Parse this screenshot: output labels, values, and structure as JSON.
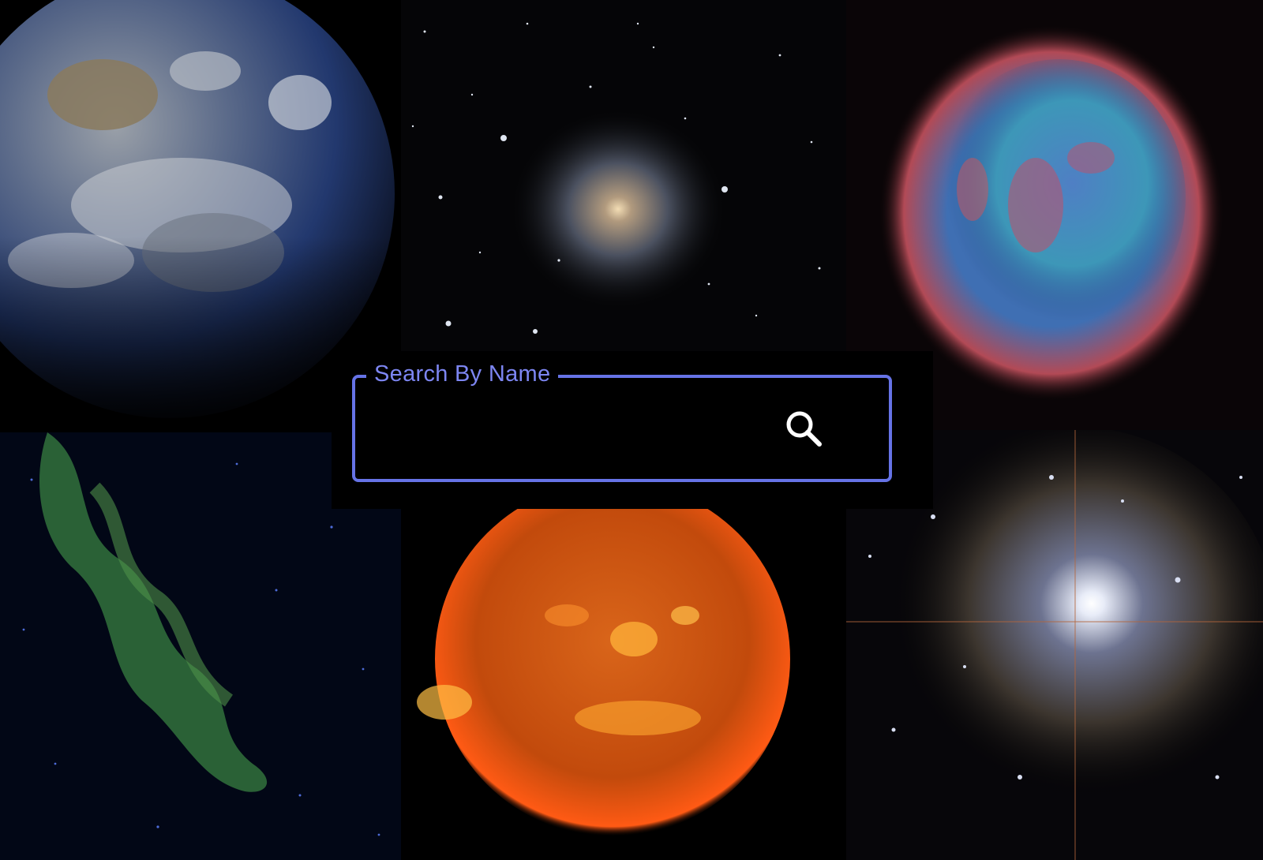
{
  "search": {
    "label": "Search By Name",
    "value": "",
    "placeholder": ""
  },
  "icons": {
    "search": "search-icon"
  },
  "colors": {
    "accent": "#6673e6",
    "label": "#7d86f2",
    "background": "#000000"
  },
  "gallery": [
    {
      "subject": "earth"
    },
    {
      "subject": "spiral-galaxy"
    },
    {
      "subject": "planetary-nebula"
    },
    {
      "subject": "green-nebula"
    },
    {
      "subject": "sun"
    },
    {
      "subject": "star-cluster"
    }
  ]
}
